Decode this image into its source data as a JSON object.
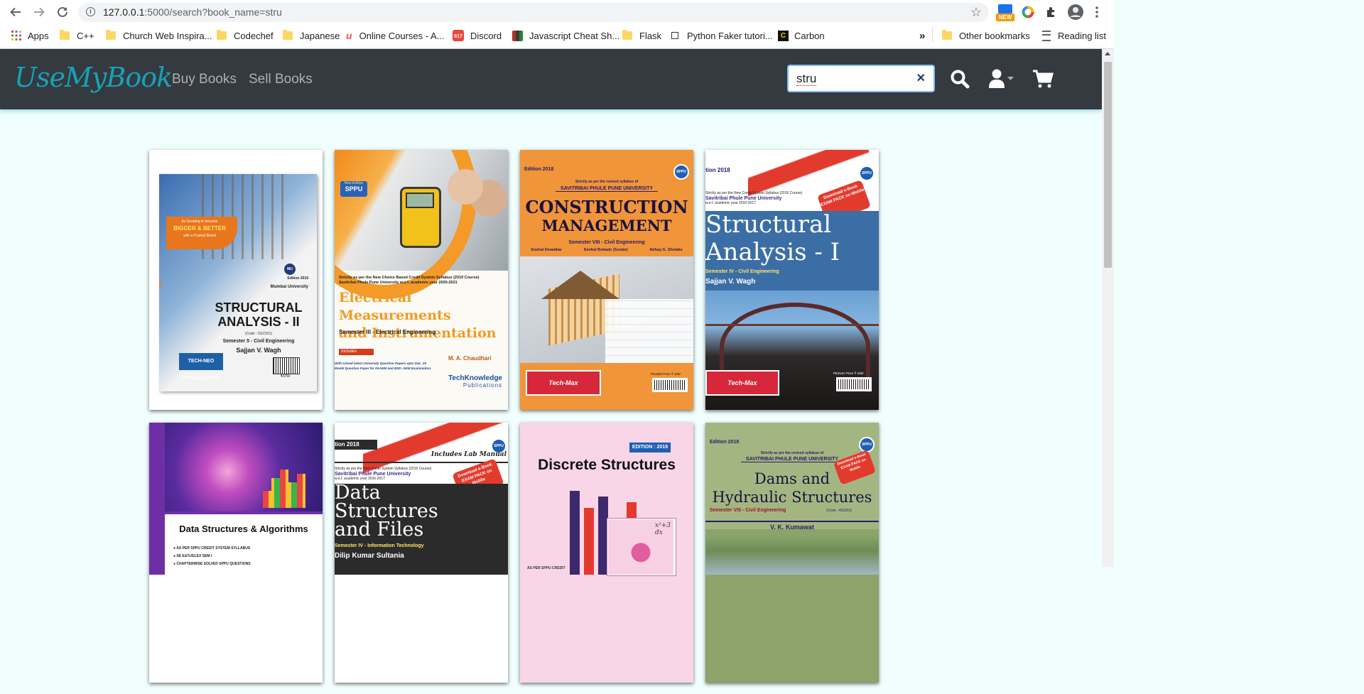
{
  "browser": {
    "url_host": "127.0.0.1",
    "url_rest": ":5000/search?book_name=stru",
    "ext_new_badge": "NEW",
    "bookmarks": [
      {
        "label": "Apps",
        "icon": "apps-grid-icon"
      },
      {
        "label": "C++",
        "icon": "folder-icon"
      },
      {
        "label": "Church Web Inspira...",
        "icon": "folder-icon"
      },
      {
        "label": "Codechef",
        "icon": "folder-icon"
      },
      {
        "label": "Japanese",
        "icon": "folder-icon"
      },
      {
        "label": "Online Courses - A...",
        "icon": "udemy-icon"
      },
      {
        "label": "Discord",
        "icon": "discord-icon"
      },
      {
        "label": "Javascript Cheat Sh...",
        "icon": "js-cheatsheet-icon"
      },
      {
        "label": "Flask",
        "icon": "folder-icon"
      },
      {
        "label": "Python Faker tutori...",
        "icon": "page-icon"
      },
      {
        "label": "Carbon",
        "icon": "carbon-icon"
      }
    ],
    "overflow": "»",
    "other_bookmarks": "Other bookmarks",
    "reading_list": "Reading list"
  },
  "site": {
    "logo": "UseMyBook",
    "nav": [
      "Buy Books",
      "Sell Books"
    ],
    "search_value": "stru",
    "clear_symbol": "×",
    "accent": "#17a2b8",
    "navbar_bg": "#343a40"
  },
  "books": [
    {
      "title_line1": "STRUCTURAL",
      "title_line2": "ANALYSIS - II",
      "tagline_a": "Its Greeting to become",
      "tagline_b": "BIGGER & BETTER",
      "tagline_c": "with a Trusted Brand",
      "edition": "Edition 2019",
      "university": "Mumbai University",
      "code": "(Code : CEC501)",
      "semester": "Semester 5 - Civil Engineering",
      "author": "Sajjan V. Wagh",
      "publisher": "TECH-NEO PUBLICATIONS",
      "price": "₹370/-",
      "badge": "MU"
    },
    {
      "badge": "SPPU",
      "badge_top": "New Edition",
      "syllabus_a": "Strictly as per the New Choice Based Credit System Syllabus (2019 Course)",
      "syllabus_b": "Savitribai Phule Pune University w.e.f. academic year 2020-2021",
      "title_line1": "Electrical Measurements",
      "title_line2": "and Instrumentation",
      "semester": "Semester III - Electrical Engineering",
      "includes": "Includes",
      "author": "M. A. Chaudhari",
      "note_a": "With solved latest University Question Papers upto Dec. 19",
      "note_b": "Model Question Paper for IN-SEM and END -SEM Examination.",
      "publisher": "TechKnowledge",
      "publisher_sub": "Publications"
    },
    {
      "edition": "Edition 2018",
      "badge": "SPPU",
      "syllabus": "Strictly as per the revised syllabus of",
      "university": "SAVITRIBAI PHULE PUNE UNIVERSITY",
      "title_line1": "CONSTRUCTION",
      "title_line2": "MANAGEMENT",
      "semester": "Semester VIII - Civil Engineering",
      "authors": [
        "Snehal Dewalkar",
        "Snehal Bobade (Sorate)",
        "Abhay G. Shelake"
      ],
      "publisher": "Tech-Max",
      "price": "PE1660  Price ₹ 108/-"
    },
    {
      "edition": "tion 2018",
      "badge": "SPPU",
      "syllabus_a": "Strictly as per the New Credit System Syllabus (2015 Course)",
      "university": "Savitribai Phule Pune University",
      "syllabus_b": "w.e.f. academic year 2016-2017",
      "promo": "Download e-Book EXAM PACK on Mobile",
      "title_line1": "Structural",
      "title_line2": "Analysis - I",
      "semester": "Semester IV - Civil Engineering",
      "author": "Sajjan V. Wagh",
      "publisher": "Tech-Max",
      "price": "PE314C  Price ₹ 185/-"
    },
    {
      "title": "Data Structures & Algorithms",
      "points": [
        "AS PER SPPU CREDIT SYSTEM SYLLABUS",
        "SE E&Tc/ELEX SEM I",
        "CHAPTERWISE SOLVED SPPU QUESTIONS"
      ]
    },
    {
      "edition": "tion 2018",
      "badge": "SPPU",
      "lab": "Includes Lab Manual",
      "syllabus_a": "Strictly as per the New Credit System Syllabus (2015 Course)",
      "university": "Savitribai Phule Pune University",
      "syllabus_b": "w.e.f. academic year 2016-2017",
      "promo": "Download e-Book EXAM PACK on Mobile",
      "title_line1": "Data",
      "title_line2": "Structures",
      "title_line3": "and Files",
      "semester": "Semester IV - Information Technology",
      "author": "Dilip Kumar Sultania"
    },
    {
      "edition": "EDITION : 2018",
      "title": "Discrete Structures",
      "footer": "AS PER SPPU CREDIT"
    },
    {
      "edition": "Edition 2018",
      "badge": "SPPU",
      "syllabus": "Strictly as per the revised syllabus of",
      "university": "SAVITRIBAI PHULE PUNE UNIVERSITY",
      "promo": "Download e-Book EXAM PACK on Mobile",
      "title_line1": "Dams and",
      "title_line2": "Hydraulic Structures",
      "semester": "Semester VIII - Civil Engineering",
      "code": "(Code : 401001)",
      "author": "V. K. Kumawat"
    }
  ]
}
